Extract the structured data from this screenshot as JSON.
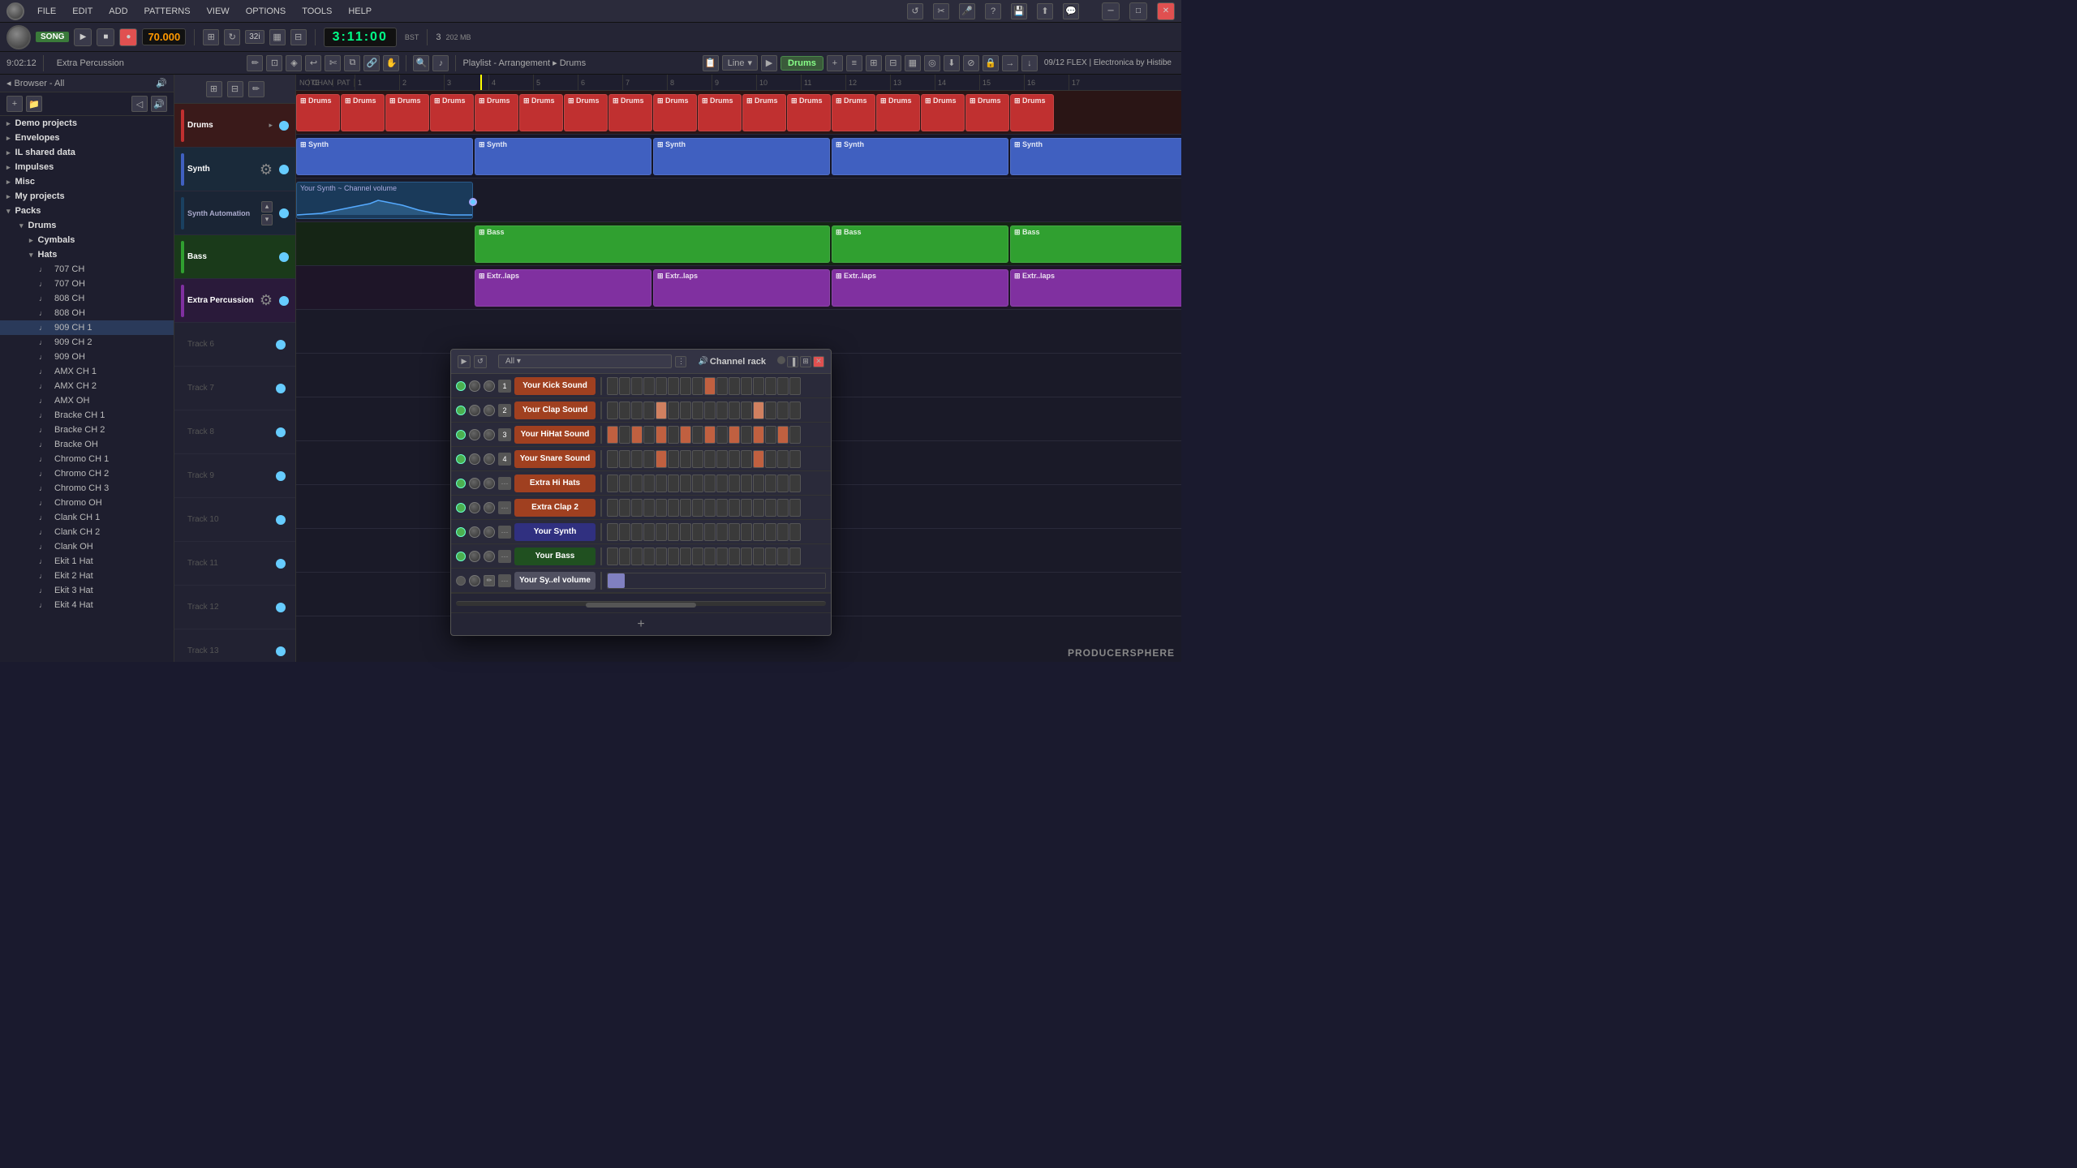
{
  "menubar": {
    "items": [
      "FILE",
      "EDIT",
      "ADD",
      "PATTERNS",
      "VIEW",
      "OPTIONS",
      "TOOLS",
      "HELP"
    ]
  },
  "transport": {
    "song_label": "SONG",
    "bpm": "70.000",
    "time": "3:11:00",
    "time_counter": "9:02:12",
    "pattern_label": "Extra Percussion",
    "cpu": "202 MB",
    "flex_info": "09/12  FLEX | Electronica by Histibe"
  },
  "sidebar": {
    "header": "Browser - All",
    "items": [
      {
        "label": "Demo projects",
        "level": 0,
        "arrow": "▸"
      },
      {
        "label": "Envelopes",
        "level": 0,
        "arrow": "▸"
      },
      {
        "label": "IL shared data",
        "level": 0,
        "arrow": "▸"
      },
      {
        "label": "Impulses",
        "level": 0,
        "arrow": "▸"
      },
      {
        "label": "Misc",
        "level": 0,
        "arrow": "▸"
      },
      {
        "label": "My projects",
        "level": 0,
        "arrow": "▸"
      },
      {
        "label": "Packs",
        "level": 0,
        "arrow": "▾"
      },
      {
        "label": "Drums",
        "level": 1,
        "arrow": "▾"
      },
      {
        "label": "Cymbals",
        "level": 2,
        "arrow": "▸"
      },
      {
        "label": "Hats",
        "level": 2,
        "arrow": "▾"
      },
      {
        "label": "707 CH",
        "level": 3
      },
      {
        "label": "707 OH",
        "level": 3
      },
      {
        "label": "808 CH",
        "level": 3
      },
      {
        "label": "808 OH",
        "level": 3
      },
      {
        "label": "909 CH 1",
        "level": 3,
        "selected": true
      },
      {
        "label": "909 CH 2",
        "level": 3
      },
      {
        "label": "909 OH",
        "level": 3
      },
      {
        "label": "AMX CH 1",
        "level": 3
      },
      {
        "label": "AMX CH 2",
        "level": 3
      },
      {
        "label": "AMX OH",
        "level": 3
      },
      {
        "label": "Bracke CH 1",
        "level": 3
      },
      {
        "label": "Bracke CH 2",
        "level": 3
      },
      {
        "label": "Bracke OH",
        "level": 3
      },
      {
        "label": "Chromo CH 1",
        "level": 3
      },
      {
        "label": "Chromo CH 2",
        "level": 3
      },
      {
        "label": "Chromo CH 3",
        "level": 3
      },
      {
        "label": "Chromo OH",
        "level": 3
      },
      {
        "label": "Clank CH 1",
        "level": 3
      },
      {
        "label": "Clank CH 2",
        "level": 3
      },
      {
        "label": "Clank OH",
        "level": 3
      },
      {
        "label": "Ekit 1 Hat",
        "level": 3
      },
      {
        "label": "Ekit 2 Hat",
        "level": 3
      },
      {
        "label": "Ekit 3 Hat",
        "level": 3
      },
      {
        "label": "Ekit 4 Hat",
        "level": 3
      }
    ]
  },
  "tracks": [
    {
      "name": "Drums",
      "color": "#c03030",
      "type": "drums"
    },
    {
      "name": "Synth",
      "color": "#4060c0",
      "type": "synth"
    },
    {
      "name": "Synth Automation",
      "color": "#1a4060",
      "type": "synth-auto"
    },
    {
      "name": "Bass",
      "color": "#30a030",
      "type": "bass"
    },
    {
      "name": "Extra Percussion",
      "color": "#8030a0",
      "type": "extra"
    }
  ],
  "playlist": {
    "label": "Playlist",
    "sub_label": "Arrangement",
    "pattern_label": "Drums",
    "ruler_marks": [
      "1",
      "2",
      "3",
      "4",
      "5",
      "6",
      "7",
      "8",
      "9",
      "10",
      "11",
      "12",
      "13",
      "14",
      "15",
      "16",
      "17"
    ]
  },
  "channel_rack": {
    "title": "Channel rack",
    "filter": "All",
    "channels": [
      {
        "num": "1",
        "name": "Your Kick Sound",
        "color": "#c05030",
        "pads": [
          0,
          0,
          0,
          0,
          0,
          0,
          0,
          0,
          1,
          0,
          0,
          0,
          0,
          0,
          0,
          0
        ]
      },
      {
        "num": "2",
        "name": "Your Clap Sound",
        "color": "#c05030",
        "pads": [
          0,
          0,
          0,
          0,
          1,
          0,
          0,
          0,
          0,
          0,
          0,
          0,
          1,
          0,
          0,
          0
        ]
      },
      {
        "num": "3",
        "name": "Your HiHat Sound",
        "color": "#c05030",
        "pads": [
          1,
          0,
          1,
          0,
          1,
          0,
          1,
          0,
          1,
          0,
          1,
          0,
          1,
          0,
          1,
          0
        ]
      },
      {
        "num": "4",
        "name": "Your Snare Sound",
        "color": "#c05030",
        "pads": [
          0,
          0,
          0,
          0,
          1,
          0,
          0,
          0,
          0,
          0,
          0,
          0,
          1,
          0,
          0,
          0
        ]
      },
      {
        "num": "---",
        "name": "Extra Hi Hats",
        "color": "#c05030",
        "pads": [
          0,
          0,
          0,
          0,
          0,
          0,
          0,
          0,
          0,
          0,
          0,
          0,
          0,
          0,
          0,
          0
        ]
      },
      {
        "num": "---",
        "name": "Extra Clap 2",
        "color": "#c05030",
        "pads": [
          0,
          0,
          0,
          0,
          0,
          0,
          0,
          0,
          0,
          0,
          0,
          0,
          0,
          0,
          0,
          0
        ]
      },
      {
        "num": "---",
        "name": "Your Synth",
        "color": "#5050c0",
        "pads": [
          0,
          0,
          0,
          0,
          0,
          0,
          0,
          0,
          0,
          0,
          0,
          0,
          0,
          0,
          0,
          0
        ]
      },
      {
        "num": "---",
        "name": "Your Bass",
        "color": "#30a030",
        "pads": [
          0,
          0,
          0,
          0,
          0,
          0,
          0,
          0,
          0,
          0,
          0,
          0,
          0,
          0,
          0,
          0
        ]
      },
      {
        "num": "---",
        "name": "Your Sy..el volume",
        "color": "#8080a0",
        "pads": [
          1,
          0,
          0,
          0,
          0,
          0,
          0,
          0,
          0,
          0,
          0,
          0,
          0,
          0,
          0,
          0
        ],
        "is_volume": true
      }
    ],
    "add_label": "+"
  },
  "mixer": {
    "label": "Drums"
  },
  "bottom": {
    "producer": "PRODUCERSPHERE"
  }
}
